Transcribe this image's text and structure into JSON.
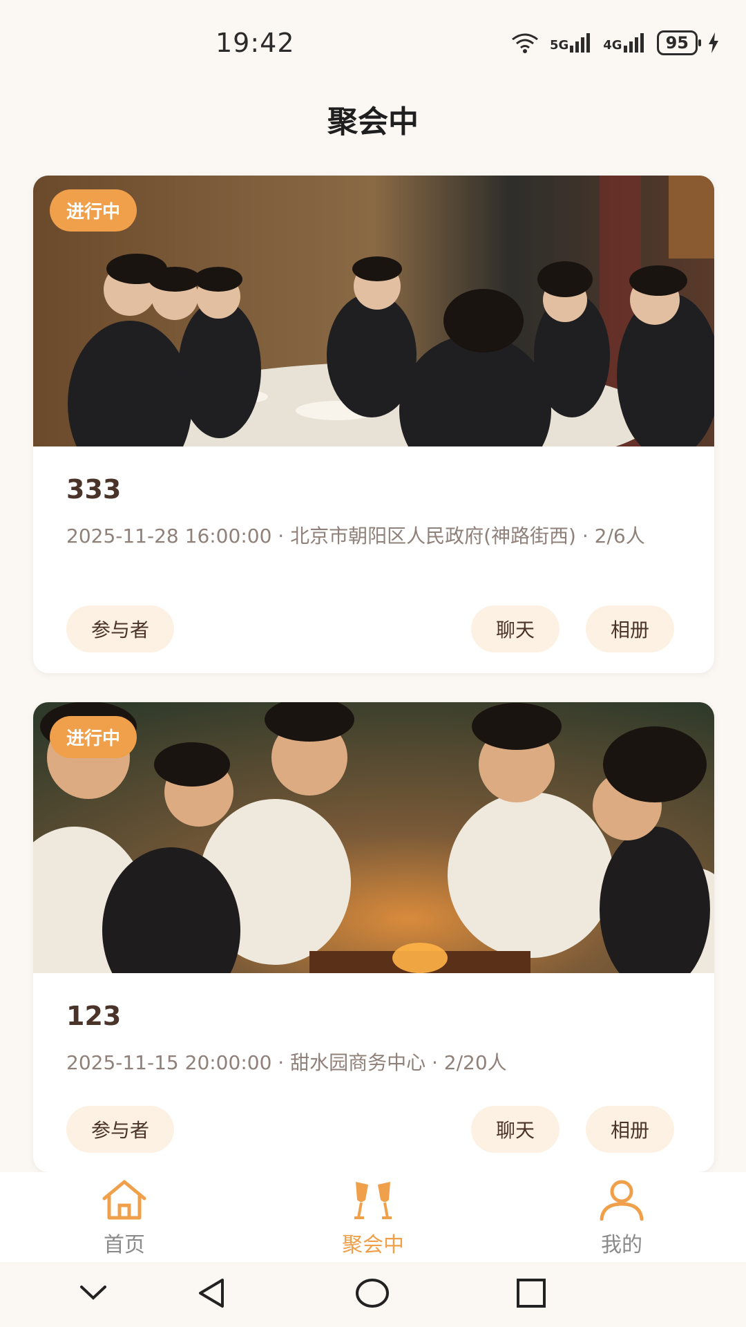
{
  "status_bar": {
    "time": "19:42",
    "network_5g": "5G",
    "network_4g": "4G",
    "battery": "95"
  },
  "page": {
    "title": "聚会中"
  },
  "cards": [
    {
      "status": "进行中",
      "title": "333",
      "meta": "2025-11-28 16:00:00 · 北京市朝阳区人民政府(神路街西) · 2/6人",
      "buttons": {
        "participants": "参与者",
        "chat": "聊天",
        "album": "相册"
      }
    },
    {
      "status": "进行中",
      "title": "123",
      "meta": "2025-11-15 20:00:00 · 甜水园商务中心 · 2/20人",
      "buttons": {
        "participants": "参与者",
        "chat": "聊天",
        "album": "相册"
      }
    }
  ],
  "bottom_nav": [
    {
      "label": "首页",
      "icon": "home-icon",
      "active": false
    },
    {
      "label": "聚会中",
      "icon": "cheers-icon",
      "active": true
    },
    {
      "label": "我的",
      "icon": "user-icon",
      "active": false
    }
  ],
  "colors": {
    "accent": "#f0a04b",
    "chip_bg": "#fdf1e3",
    "page_bg": "#fbf7f2"
  }
}
